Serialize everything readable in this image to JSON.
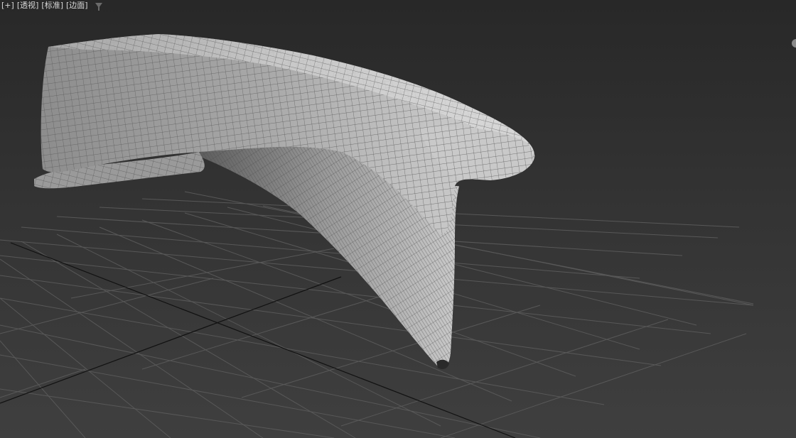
{
  "viewport": {
    "labels": {
      "plus": "[+]",
      "view": "[透视]",
      "shading": "[标准]",
      "mode": "[边面]"
    },
    "filter_icon": "filter-funnel-icon",
    "viewcube_icon": "viewcube-navigation-icon",
    "colors": {
      "background_top": "#282828",
      "background_bottom": "#3f3f3f",
      "grid": "#5a5a5a",
      "axis": "#111111",
      "mesh_fill": "#b9b9b9",
      "wire": "#565656"
    }
  }
}
